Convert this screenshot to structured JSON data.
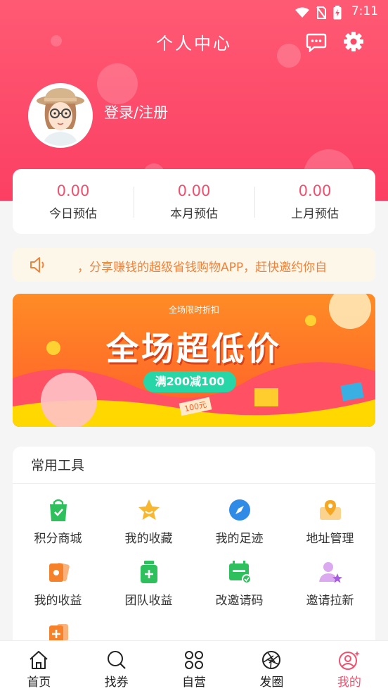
{
  "status_bar": {
    "time": "7:11"
  },
  "header": {
    "title": "个人中心",
    "login_label": "登录/注册"
  },
  "stats": [
    {
      "value": "0.00",
      "label": "今日预估"
    },
    {
      "value": "0.00",
      "label": "本月预估"
    },
    {
      "value": "0.00",
      "label": "上月预估"
    }
  ],
  "notice": {
    "text": "，分享赚钱的超级省钱购物APP，赶快邀约你自"
  },
  "banner": {
    "subtitle": "全场限时折扣",
    "headline": "全场超低价",
    "promo": "满200减100",
    "coupon": "100元"
  },
  "tools": {
    "title": "常用工具",
    "items": [
      {
        "label": "积分商城",
        "icon": "shopping-bag-icon",
        "color": "#2ec05c"
      },
      {
        "label": "我的收藏",
        "icon": "star-icon",
        "color": "#f7b731"
      },
      {
        "label": "我的足迹",
        "icon": "compass-icon",
        "color": "#2f8be6"
      },
      {
        "label": "地址管理",
        "icon": "map-pin-icon",
        "color": "#f5a623"
      },
      {
        "label": "我的收益",
        "icon": "earnings-cards-icon",
        "color": "#f5822a"
      },
      {
        "label": "团队收益",
        "icon": "jar-plus-icon",
        "color": "#2ec05c"
      },
      {
        "label": "改邀请码",
        "icon": "calendar-check-icon",
        "color": "#2ec05c"
      },
      {
        "label": "邀请拉新",
        "icon": "user-star-icon",
        "color": "#c58be6"
      }
    ]
  },
  "tabbar": {
    "items": [
      {
        "label": "首页",
        "icon": "home-icon"
      },
      {
        "label": "找券",
        "icon": "search-icon"
      },
      {
        "label": "自营",
        "icon": "grid-icon"
      },
      {
        "label": "发圈",
        "icon": "aperture-icon"
      },
      {
        "label": "我的",
        "icon": "profile-icon",
        "active": true
      }
    ]
  },
  "colors": {
    "primary": "#fb3f63",
    "accent_text": "#f0506e",
    "notice_text": "#f0823c",
    "banner": "#ff6a28"
  }
}
